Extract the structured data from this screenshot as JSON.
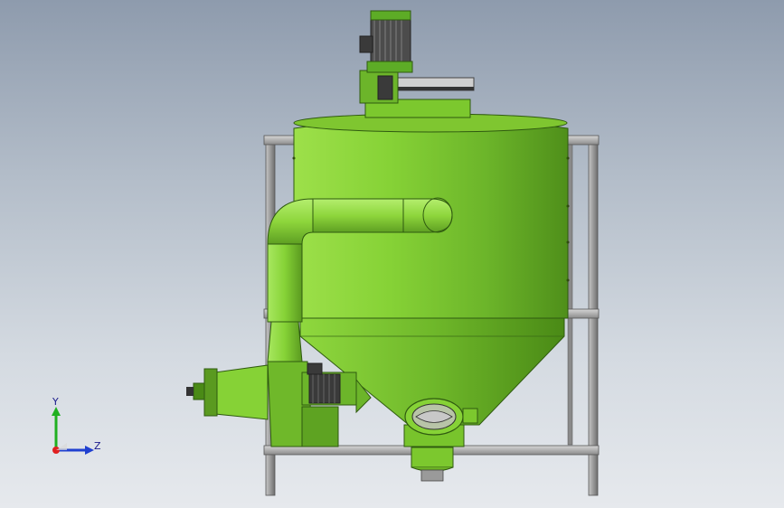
{
  "scene": {
    "description_colors": {
      "background_top": "#8e9bad",
      "background_bottom": "#e6e9ed",
      "body_green": "#7ccc2e",
      "body_green_dark": "#4f8f1a",
      "frame_gray": "#9a9a9a",
      "axis_x": "#e02020",
      "axis_y": "#20b020",
      "axis_z": "#2040d0"
    }
  },
  "triad": {
    "y_label": "Y",
    "z_label": "Z"
  }
}
